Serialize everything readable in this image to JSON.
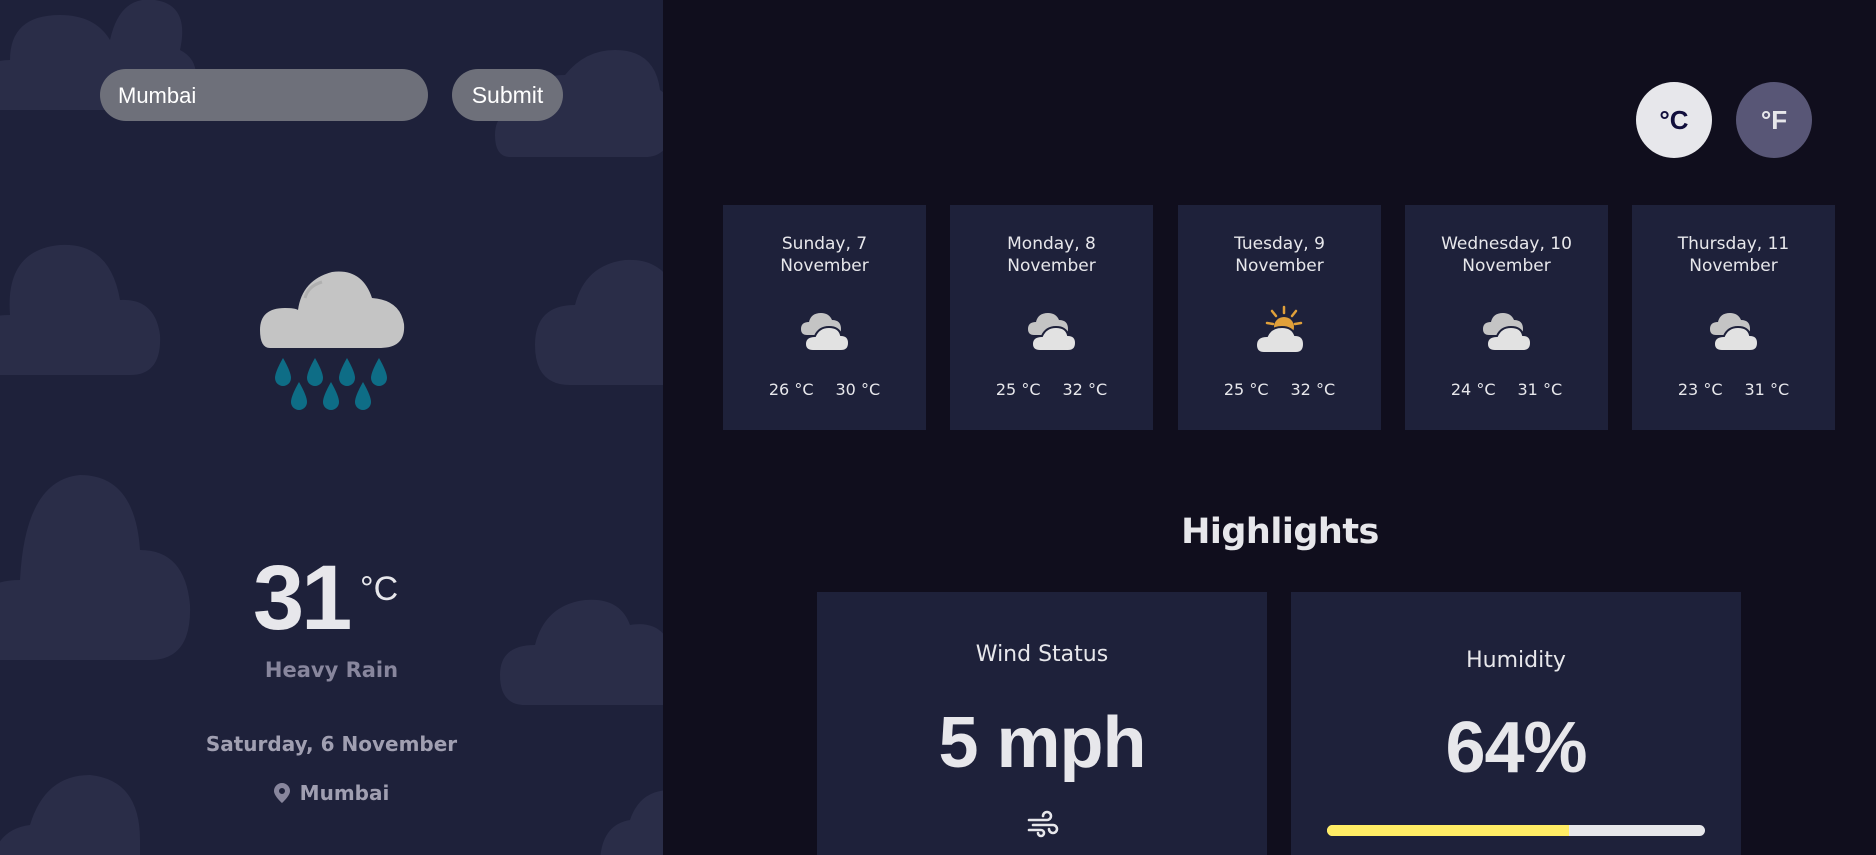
{
  "search": {
    "value": "Mumbai",
    "submit_label": "Submit"
  },
  "current": {
    "icon": "heavy-rain-icon",
    "temperature": "31",
    "unit": "°C",
    "condition": "Heavy Rain",
    "date": "Saturday, 6 November",
    "location": "Mumbai"
  },
  "units": {
    "celsius_label": "°C",
    "fahrenheit_label": "°F",
    "selected": "celsius"
  },
  "forecast": [
    {
      "day": "Sunday, 7",
      "month": "November",
      "icon": "cloudy-icon",
      "min": "26 °C",
      "max": "30 °C"
    },
    {
      "day": "Monday, 8",
      "month": "November",
      "icon": "cloudy-icon",
      "min": "25 °C",
      "max": "32 °C"
    },
    {
      "day": "Tuesday, 9",
      "month": "November",
      "icon": "partly-sunny-icon",
      "min": "25 °C",
      "max": "32 °C"
    },
    {
      "day": "Wednesday, 10",
      "month": "November",
      "icon": "cloudy-icon",
      "min": "24 °C",
      "max": "31 °C"
    },
    {
      "day": "Thursday, 11",
      "month": "November",
      "icon": "cloudy-icon",
      "min": "23 °C",
      "max": "31 °C"
    }
  ],
  "highlights": {
    "title": "Highlights",
    "wind": {
      "label": "Wind Status",
      "value": "5 mph",
      "icon": "wind-icon"
    },
    "humidity": {
      "label": "Humidity",
      "value": "64%",
      "percent": 64
    }
  },
  "colors": {
    "left_panel": "#1e213a",
    "background": "#100e1d",
    "humidity_fill": "#ffec65",
    "rain_drop": "#0e6d86"
  }
}
